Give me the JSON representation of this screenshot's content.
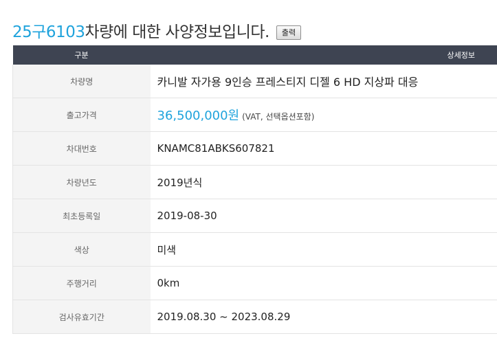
{
  "header": {
    "plate": "25구6103",
    "title_suffix": " 차량에 대한 사양정보입니다.",
    "print_label": "출력"
  },
  "table": {
    "col_label": "구분",
    "col_value": "상세정보",
    "rows": [
      {
        "label": "차량명",
        "value": "카니발 자가용 9인승 프레스티지 디젤 6 HD 지상파 대응"
      },
      {
        "label": "출고가격",
        "value": "36,500,000원",
        "note": "(VAT, 선택옵션포함)"
      },
      {
        "label": "차대번호",
        "value": "KNAMC81ABKS607821"
      },
      {
        "label": "차량년도",
        "value": "2019년식"
      },
      {
        "label": "최초등록일",
        "value": "2019-08-30"
      },
      {
        "label": "색상",
        "value": "미색"
      },
      {
        "label": "주행거리",
        "value": "0km"
      },
      {
        "label": "검사유효기간",
        "value": "2019.08.30 ~ 2023.08.29"
      }
    ]
  },
  "colors": {
    "accent": "#1fa3dc",
    "header_bg": "#3e4452",
    "label_bg": "#f4f4f4"
  }
}
